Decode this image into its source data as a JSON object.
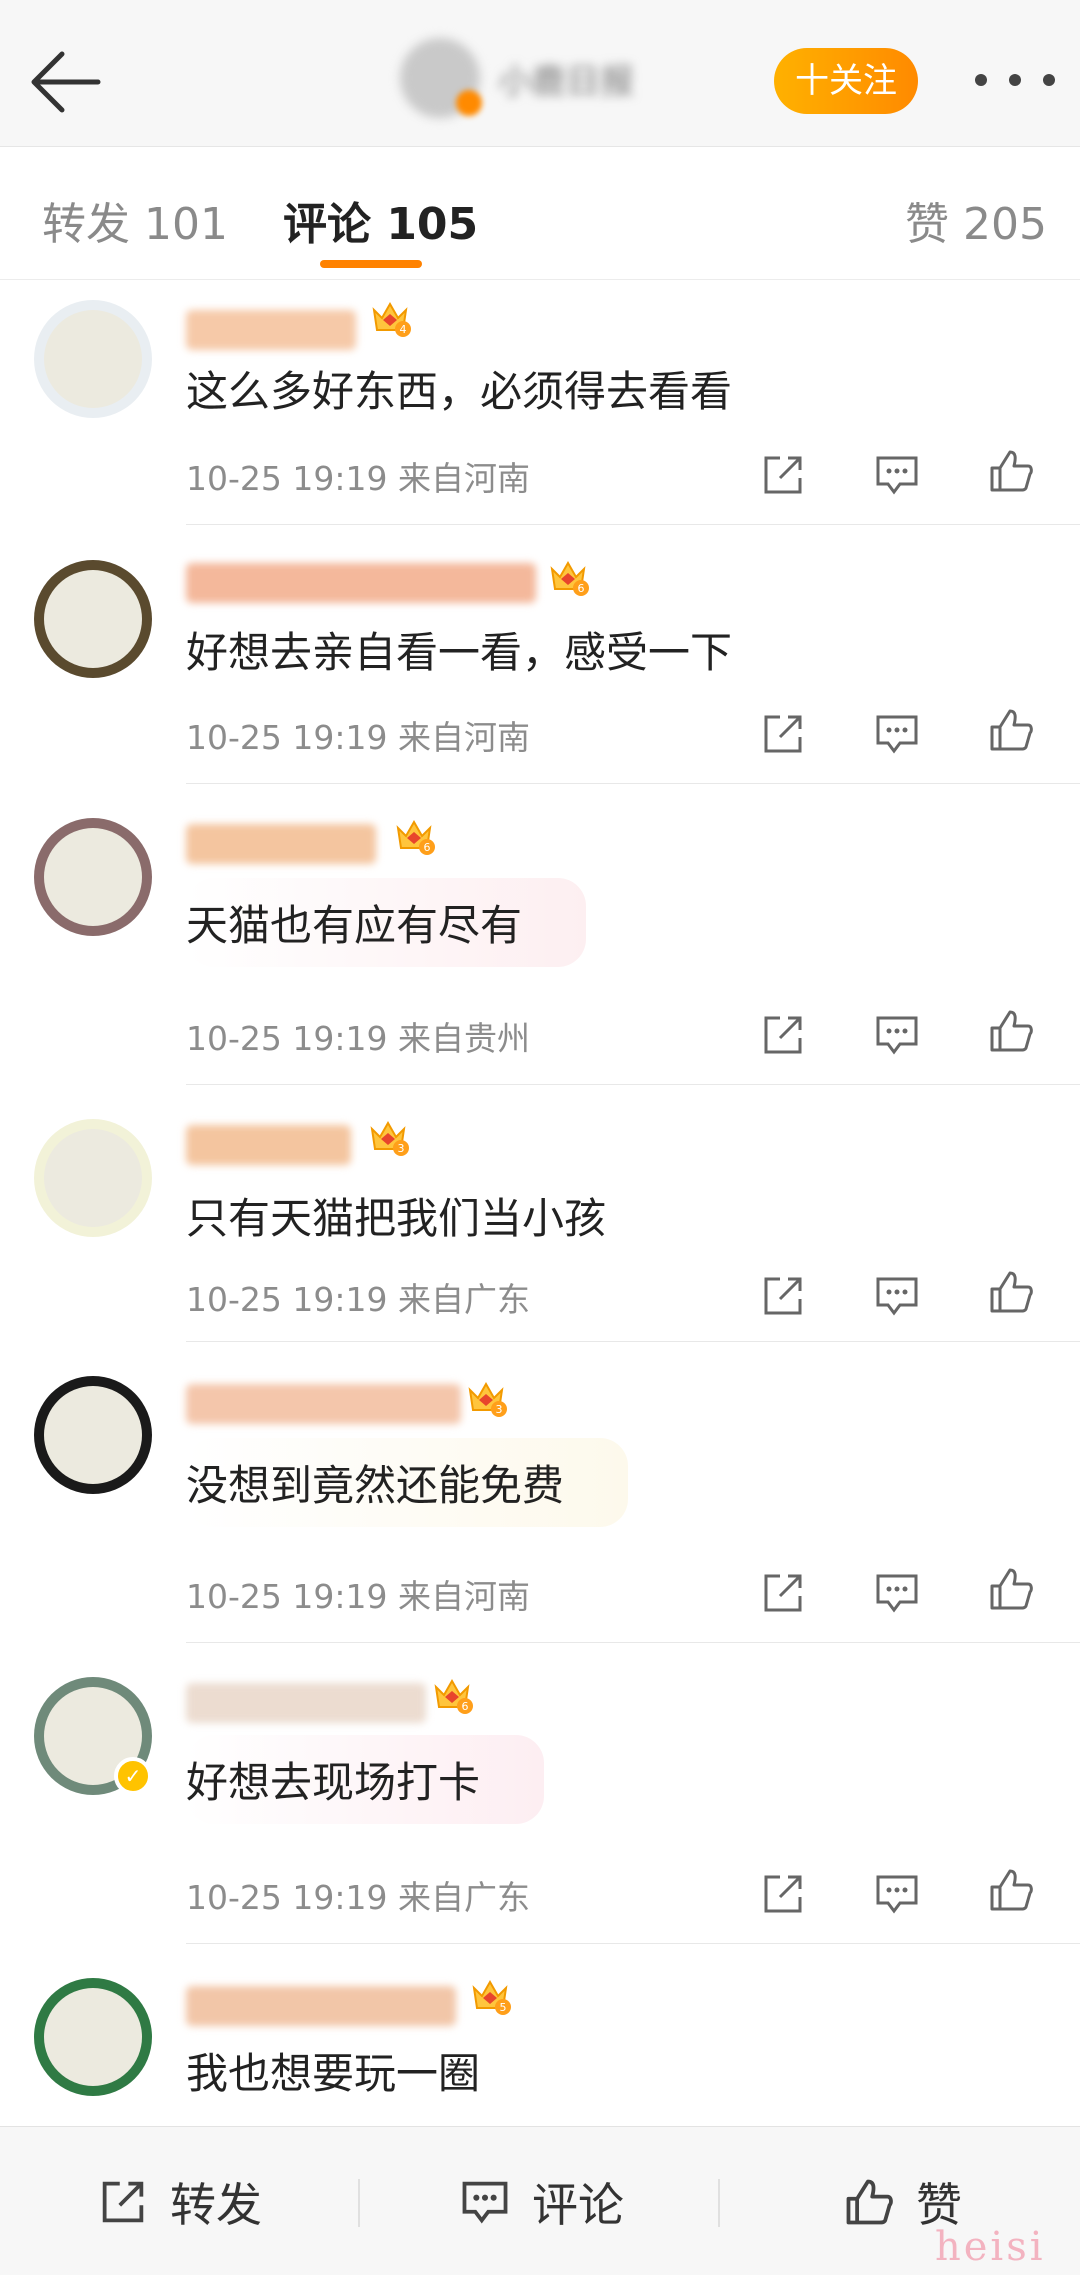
{
  "header": {
    "account_name": "小鹿日报",
    "follow_label": "十关注"
  },
  "tabs": [
    {
      "label": "转发 101"
    },
    {
      "label": "评论 105"
    },
    {
      "label": "赞 205"
    }
  ],
  "comments": [
    {
      "text": "这么多好东西，必须得去看看",
      "time": "10-25 19:19",
      "location": "来自河南",
      "level": "4"
    },
    {
      "text": "好想去亲自看一看，感受一下",
      "time": "10-25 19:19",
      "location": "来自河南",
      "level": "6"
    },
    {
      "text": "天猫也有应有尽有",
      "time": "10-25 19:19",
      "location": "来自贵州",
      "level": "6"
    },
    {
      "text": "只有天猫把我们当小孩",
      "time": "10-25 19:19",
      "location": "来自广东",
      "level": "3"
    },
    {
      "text": "没想到竟然还能免费",
      "time": "10-25 19:19",
      "location": "来自河南",
      "level": "3"
    },
    {
      "text": "好想去现场打卡",
      "time": "10-25 19:19",
      "location": "来自广东",
      "level": "6"
    },
    {
      "text": "我也想要玩一圈",
      "level": "5"
    }
  ],
  "bottom_bar": {
    "repost_label": "转发",
    "comment_label": "评论",
    "like_label": "赞"
  },
  "watermark": "heisi",
  "colors": {
    "accent": "#ff8200",
    "username": "#f0a060",
    "background": "#ffffff"
  }
}
